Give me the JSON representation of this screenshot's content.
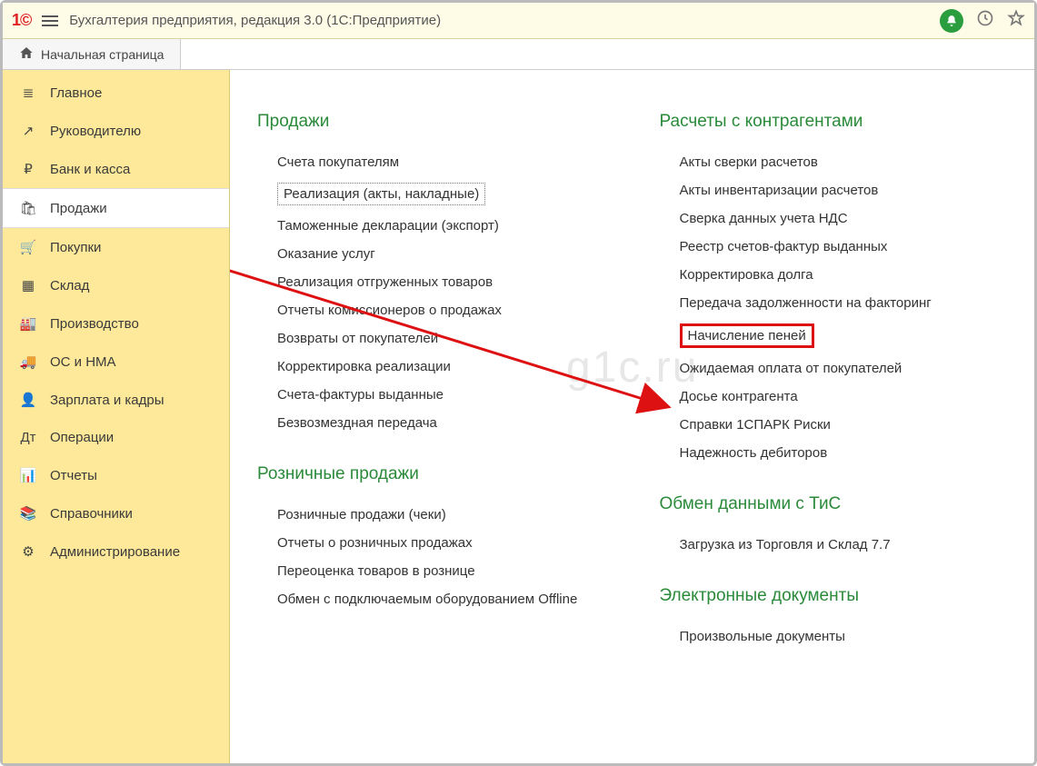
{
  "app": {
    "title": "Бухгалтерия предприятия, редакция 3.0  (1С:Предприятие)"
  },
  "home_tab": "Начальная страница",
  "sidebar": {
    "items": [
      {
        "icon": "≣",
        "label": "Главное"
      },
      {
        "icon": "↗",
        "label": "Руководителю"
      },
      {
        "icon": "₽",
        "label": "Банк и касса"
      },
      {
        "icon": "🛍",
        "label": "Продажи"
      },
      {
        "icon": "🛒",
        "label": "Покупки"
      },
      {
        "icon": "▦",
        "label": "Склад"
      },
      {
        "icon": "🏭",
        "label": "Производство"
      },
      {
        "icon": "🚚",
        "label": "ОС и НМА"
      },
      {
        "icon": "👤",
        "label": "Зарплата и кадры"
      },
      {
        "icon": "Дт",
        "label": "Операции"
      },
      {
        "icon": "📊",
        "label": "Отчеты"
      },
      {
        "icon": "📚",
        "label": "Справочники"
      },
      {
        "icon": "⚙",
        "label": "Администрирование"
      }
    ],
    "active_index": 3
  },
  "content": {
    "col1": [
      {
        "title": "Продажи",
        "items": [
          "Счета покупателям",
          "Реализация (акты, накладные)",
          "Таможенные декларации (экспорт)",
          "Оказание услуг",
          "Реализация отгруженных товаров",
          "Отчеты комиссионеров о продажах",
          "Возвраты от покупателей",
          "Корректировка реализации",
          "Счета-фактуры выданные",
          "Безвозмездная передача"
        ],
        "boxed_index": 1
      },
      {
        "title": "Розничные продажи",
        "items": [
          "Розничные продажи (чеки)",
          "Отчеты о розничных продажах",
          "Переоценка товаров в рознице",
          "Обмен с подключаемым оборудованием Offline"
        ]
      }
    ],
    "col2": [
      {
        "title": "Расчеты с контрагентами",
        "items": [
          "Акты сверки расчетов",
          "Акты инвентаризации расчетов",
          "Сверка данных учета НДС",
          "Реестр счетов-фактур выданных",
          "Корректировка долга",
          "Передача задолженности на факторинг",
          "Начисление пеней",
          "Ожидаемая оплата от покупателей",
          "Досье контрагента",
          "Справки 1СПАРК Риски",
          "Надежность дебиторов"
        ],
        "highlight_index": 6
      },
      {
        "title": "Обмен данными с ТиС",
        "items": [
          "Загрузка из Торговля и Склад 7.7"
        ]
      },
      {
        "title": "Электронные документы",
        "items": [
          "Произвольные документы"
        ]
      }
    ]
  },
  "watermark": "g1c.ru"
}
